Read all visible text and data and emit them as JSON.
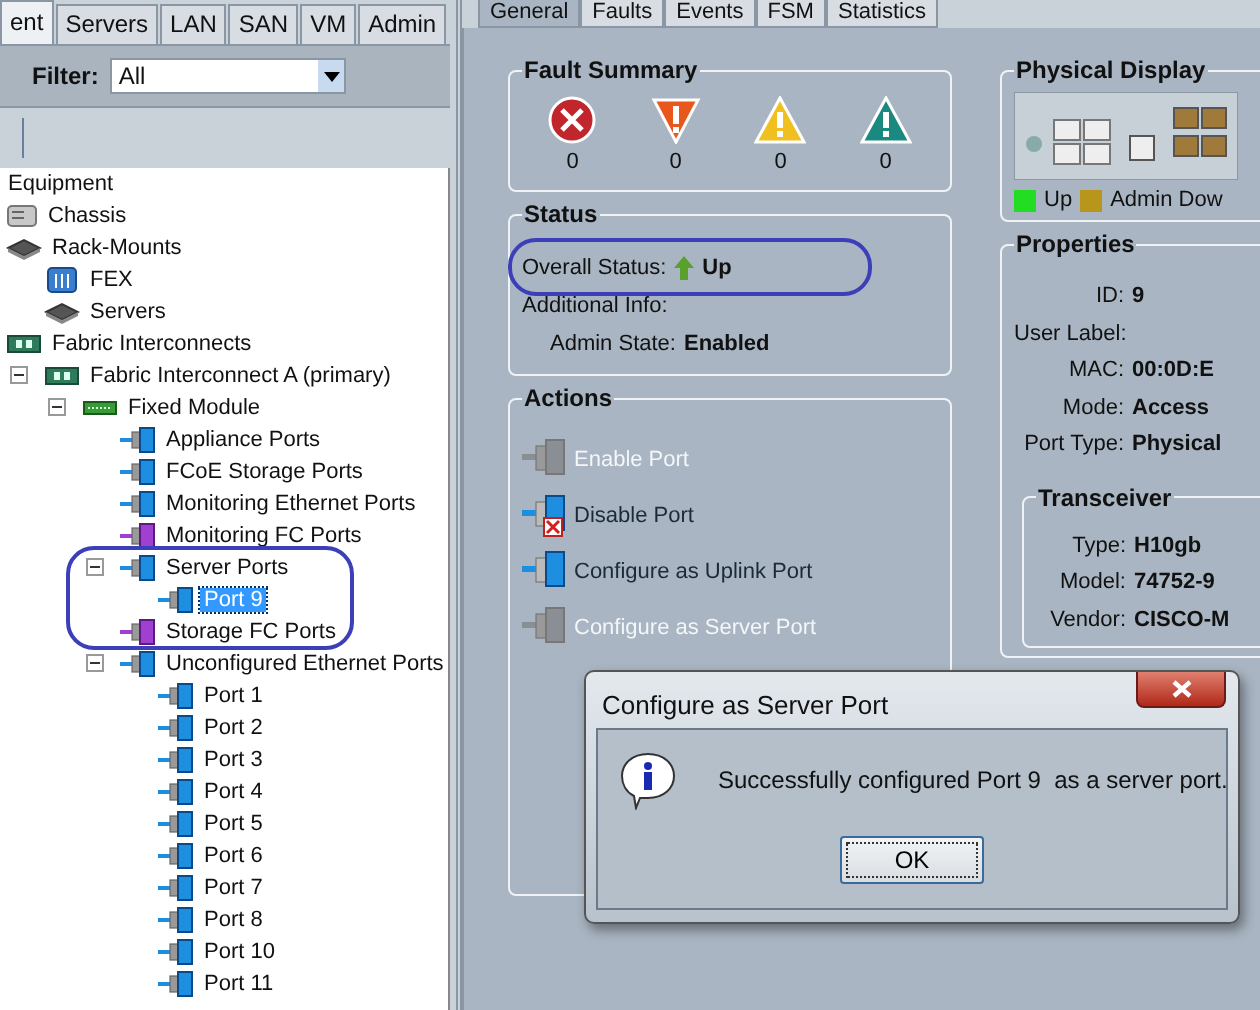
{
  "left_panel": {
    "tabs": [
      {
        "label": "ent",
        "selected": true
      },
      {
        "label": "Servers",
        "selected": false
      },
      {
        "label": "LAN",
        "selected": false
      },
      {
        "label": "SAN",
        "selected": false
      },
      {
        "label": "VM",
        "selected": false
      },
      {
        "label": "Admin",
        "selected": false
      }
    ],
    "filter": {
      "label": "Filter:",
      "value": "All"
    },
    "tree": [
      {
        "label": "Equipment",
        "selected": false,
        "children": [
          {
            "label": "Chassis",
            "kind": "chassis",
            "selected": false
          },
          {
            "label": "Rack-Mounts",
            "kind": "rack",
            "selected": false,
            "children": [
              {
                "label": "FEX",
                "kind": "fex",
                "selected": false
              },
              {
                "label": "Servers",
                "kind": "rack",
                "selected": false
              }
            ]
          },
          {
            "label": "Fabric Interconnects",
            "kind": "fi",
            "selected": false,
            "children": [
              {
                "label": "Fabric Interconnect A (primary)",
                "kind": "fi",
                "selected": false,
                "expanded": true,
                "children": [
                  {
                    "label": "Fixed Module",
                    "kind": "module",
                    "selected": false,
                    "expanded": true,
                    "children": [
                      {
                        "label": "Appliance Ports",
                        "kind": "port-eth",
                        "selected": false
                      },
                      {
                        "label": "FCoE Storage Ports",
                        "kind": "port-eth",
                        "selected": false
                      },
                      {
                        "label": "Monitoring Ethernet Ports",
                        "kind": "port-eth",
                        "selected": false
                      },
                      {
                        "label": "Monitoring FC Ports",
                        "kind": "port-fc",
                        "selected": false
                      },
                      {
                        "label": "Server Ports",
                        "kind": "port-eth",
                        "selected": false,
                        "expanded": true,
                        "children": [
                          {
                            "label": "Port 9",
                            "kind": "port-eth",
                            "selected": true
                          }
                        ]
                      },
                      {
                        "label": "Storage FC Ports",
                        "kind": "port-fc",
                        "selected": false
                      },
                      {
                        "label": "Unconfigured Ethernet Ports",
                        "kind": "port-eth",
                        "selected": false,
                        "expanded": true,
                        "children": [
                          {
                            "label": "Port 1",
                            "kind": "port-eth",
                            "selected": false
                          },
                          {
                            "label": "Port 2",
                            "kind": "port-eth",
                            "selected": false
                          },
                          {
                            "label": "Port 3",
                            "kind": "port-eth",
                            "selected": false
                          },
                          {
                            "label": "Port 4",
                            "kind": "port-eth",
                            "selected": false
                          },
                          {
                            "label": "Port 5",
                            "kind": "port-eth",
                            "selected": false
                          },
                          {
                            "label": "Port 6",
                            "kind": "port-eth",
                            "selected": false
                          },
                          {
                            "label": "Port 7",
                            "kind": "port-eth",
                            "selected": false
                          },
                          {
                            "label": "Port 8",
                            "kind": "port-eth",
                            "selected": false
                          },
                          {
                            "label": "Port 10",
                            "kind": "port-eth",
                            "selected": false
                          },
                          {
                            "label": "Port 11",
                            "kind": "port-eth",
                            "selected": false
                          }
                        ]
                      }
                    ]
                  }
                ]
              }
            ]
          }
        ]
      }
    ]
  },
  "detail_tabs": [
    {
      "label": "General",
      "selected": true
    },
    {
      "label": "Faults",
      "selected": false
    },
    {
      "label": "Events",
      "selected": false
    },
    {
      "label": "FSM",
      "selected": false
    },
    {
      "label": "Statistics",
      "selected": false
    }
  ],
  "fault_summary": {
    "title": "Fault Summary",
    "items": [
      {
        "kind": "critical",
        "count": "0"
      },
      {
        "kind": "major",
        "count": "0"
      },
      {
        "kind": "minor",
        "count": "0"
      },
      {
        "kind": "warning",
        "count": "0"
      }
    ]
  },
  "status": {
    "title": "Status",
    "rows": [
      {
        "kind": "status",
        "label": "Overall Status:",
        "value": "Up"
      },
      {
        "kind": "plain",
        "label": "Additional Info:"
      },
      {
        "kind": "plain",
        "label": "Admin State:",
        "value": "Enabled"
      }
    ]
  },
  "actions": {
    "title": "Actions",
    "items": [
      {
        "kind": "enable",
        "label": "Enable Port",
        "disabled": true
      },
      {
        "kind": "disable",
        "label": "Disable Port",
        "disabled": false
      },
      {
        "kind": "uplink",
        "label": "Configure as Uplink Port",
        "disabled": false
      },
      {
        "kind": "server",
        "label": "Configure as Server Port",
        "disabled": true
      }
    ]
  },
  "physical_display": {
    "title": "Physical Display",
    "legend": [
      {
        "label": "Up",
        "color": "#22dd22"
      },
      {
        "label": "Admin Dow",
        "color": "#b8961c"
      }
    ]
  },
  "properties": {
    "title": "Properties",
    "rows": [
      {
        "label": "ID:",
        "value": "9"
      },
      {
        "label": "User Label:"
      },
      {
        "label": "MAC:",
        "value": "00:0D:E"
      },
      {
        "label": "Mode:",
        "value": "Access"
      },
      {
        "label": "Port Type:",
        "value": "Physical"
      }
    ],
    "transceiver": {
      "title": "Transceiver",
      "rows": [
        {
          "label": "Type:",
          "value": "H10gb"
        },
        {
          "label": "Model:",
          "value": "74752-9"
        },
        {
          "label": "Vendor:",
          "value": "CISCO-M"
        }
      ]
    }
  },
  "dialog": {
    "title": "Configure as Server Port",
    "message": "Successfully configured Port 9  as a server port.",
    "button": "OK"
  }
}
